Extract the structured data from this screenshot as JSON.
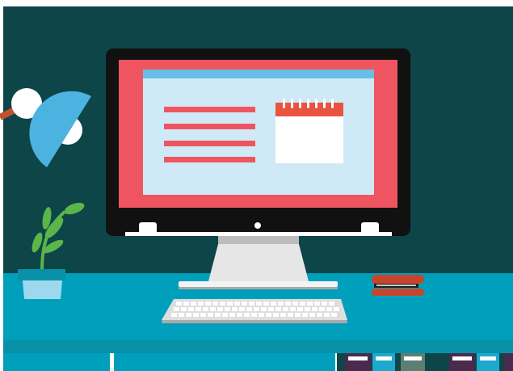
{
  "colors": {
    "wall": "#0d4548",
    "desk_top": "#00a0bd",
    "desk_front": "#0891a8",
    "monitor_bezel": "#111111",
    "screen_border": "#ef5560",
    "window_bg": "#cfe9f6",
    "window_bar": "#67bfe8",
    "calendar_header": "#e8543e",
    "calendar_body": "#ffffff",
    "lamp_shade": "#4cb3e0",
    "lamp_arm": "#c0522f",
    "plant_leaf": "#5bb548",
    "plant_pot": "#9ed8ef",
    "stapler_red": "#c7452d",
    "stand_gray": "#e6e6e6",
    "keyboard_gray": "#dedede",
    "binder_purple": "#4b2a4f",
    "binder_cyan": "#1da9cf",
    "binder_green": "#5d7f73"
  },
  "objects": [
    "desk-lamp-icon",
    "monitor-icon",
    "calendar-icon",
    "plant-icon",
    "keyboard-icon",
    "stapler-icon",
    "binders-icon"
  ]
}
